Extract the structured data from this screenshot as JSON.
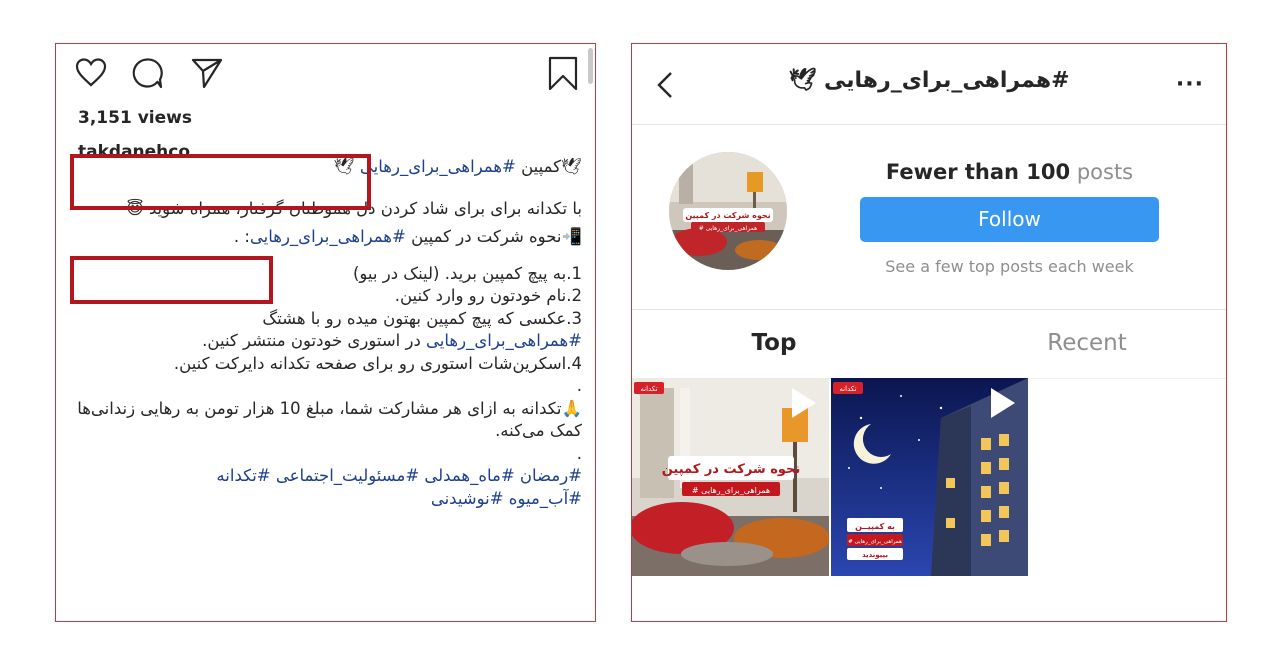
{
  "left_post": {
    "views": "3,151 views",
    "username": "takdanehco",
    "lines": {
      "l1_pre": "🕊",
      "l1_text": "کمپین ",
      "l1_tag": "#همراهی_برای_رهایی",
      "l1_post": " 🕊",
      "l2": "با تکدانه برای برای شاد کردن دل هموطنان گرفتار، همراه شوید",
      "l2_emoji": "😇",
      "l3_text": "📲نحوه شرکت در کمپین ",
      "l3_tag": "#همراهی_برای_رهایی",
      "l3_end": ":",
      "l3_dot": " .",
      "s1": "1.به پیچ کمپین برید. (لینک در بیو)",
      "s2": "2.نام خودتون رو وارد کنین.",
      "s3": "3.عکسی که پیچ کمپین بهتون میده رو با هشتگ",
      "s3b_tag": "#همراهی_برای_رهایی",
      "s3b_text": " در استوری خودتون منتشر کنین.",
      "s4": "4.اسکرین‌شات استوری رو برای صفحه تکدانه دایرکت کنین.",
      "dot1": ".",
      "p1": "🙏تکدانه به ازای هر مشارکت شما، مبلغ 10 هزار تومن به رهایی زندانی‌ها کمک می‌کنه.",
      "dot2": ".",
      "tags1": "#رمضان #ماه_همدلی #مسئولیت_اجتماعی #تکدانه",
      "tags2": "#آب_میوه #نوشیدنی"
    }
  },
  "right_profile": {
    "title": "#همراهی_برای_رهایی",
    "title_emoji": "🕊",
    "more": "···",
    "posts_count": "Fewer than 100",
    "posts_word": " posts",
    "follow_label": "Follow",
    "see_few": "See a few top posts each week",
    "tab_top": "Top",
    "tab_recent": "Recent",
    "thumb1_title": "نحوه شرکت در کمپین",
    "thumb1_tag": "# همراهی_برای_رهایی",
    "thumb1_brand": "تکدانه",
    "thumb2_join1": "به کمپیــن",
    "thumb2_join2": "# همراهی_برای_رهایی",
    "thumb2_join3": "بپیوندید",
    "thumb2_brand": "تکدانه",
    "avatar_title": "نحوه شرکت در کمپین",
    "avatar_tag": "# همراهی_برای_رهایی"
  },
  "colors": {
    "highlight_border": "#b3171d",
    "follow_blue": "#3897f0",
    "hashtag": "#1d3f8f",
    "panel_border": "#c33a3a"
  }
}
